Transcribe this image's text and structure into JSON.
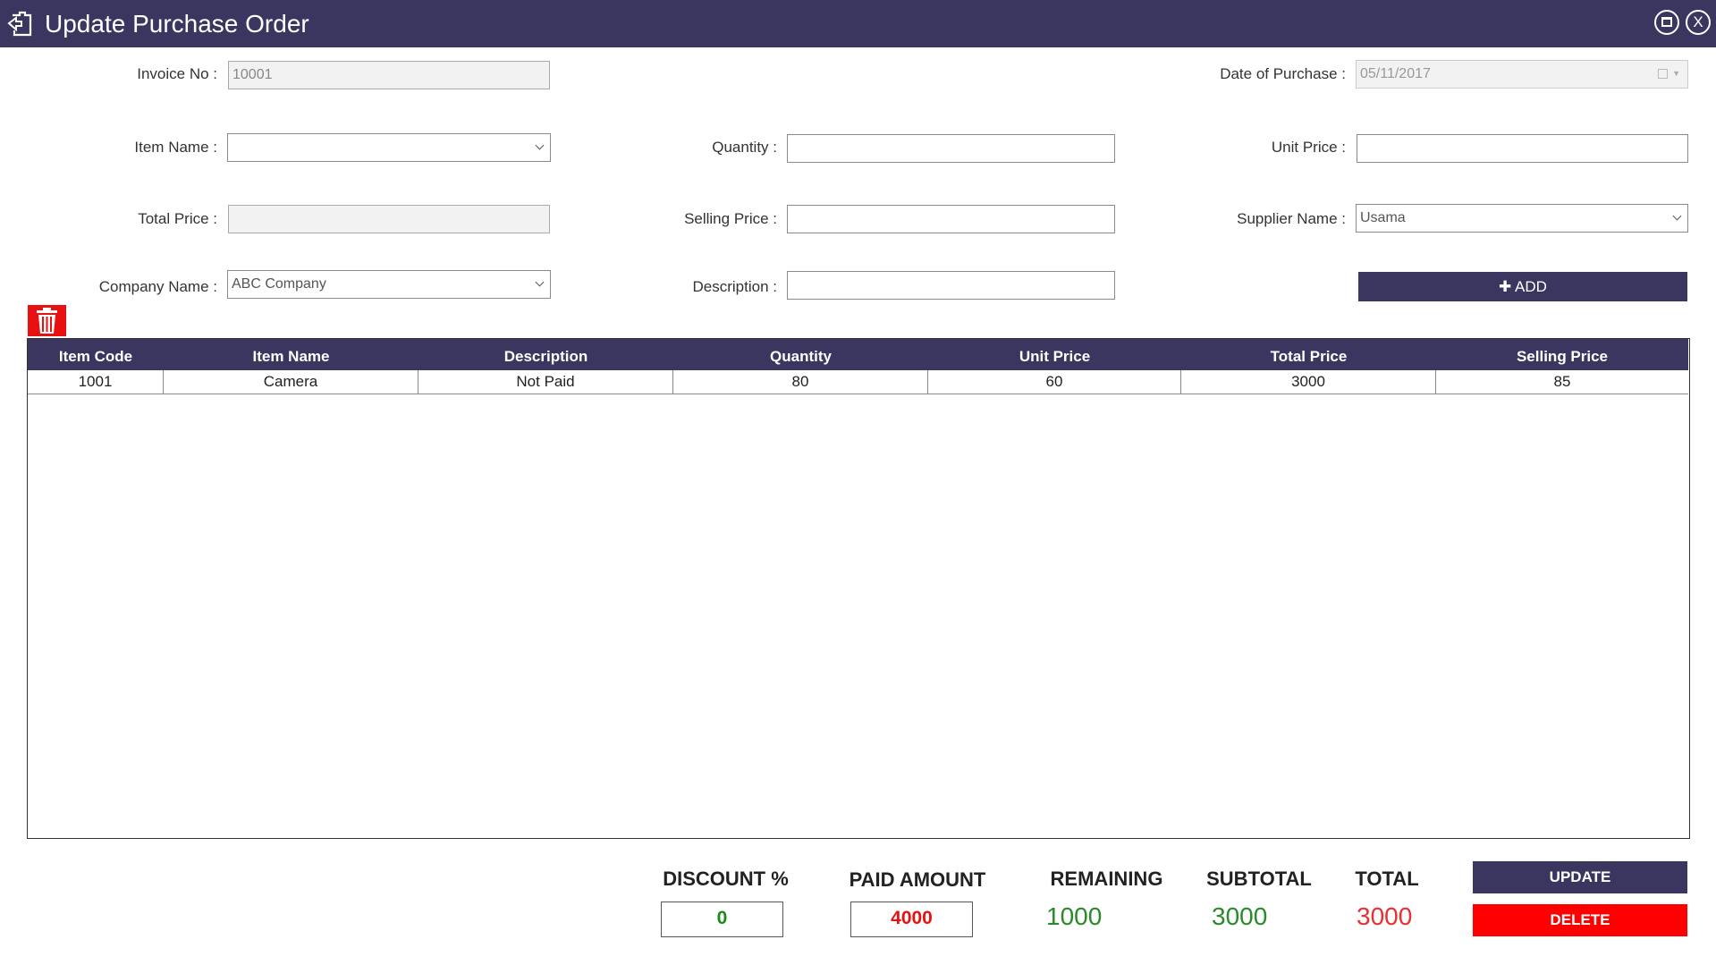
{
  "window": {
    "title": "Update Purchase Order",
    "close_label": "X",
    "accent": "#3a3660"
  },
  "form": {
    "invoice_no": {
      "label": "Invoice No :",
      "value": "10001"
    },
    "date_of_purchase": {
      "label": "Date of Purchase :",
      "value": "05/11/2017"
    },
    "item_name": {
      "label": "Item Name :",
      "value": ""
    },
    "quantity": {
      "label": "Quantity :",
      "value": ""
    },
    "unit_price": {
      "label": "Unit Price :",
      "value": ""
    },
    "total_price": {
      "label": "Total Price :",
      "value": ""
    },
    "selling_price": {
      "label": "Selling Price :",
      "value": ""
    },
    "supplier_name": {
      "label": "Supplier Name :",
      "value": "Usama"
    },
    "company_name": {
      "label": "Company Name :",
      "value": "ABC Company"
    },
    "description": {
      "label": "Description :",
      "value": ""
    },
    "add_label": "✚ ADD"
  },
  "grid": {
    "columns": [
      "Item Code",
      "Item Name",
      "Description",
      "Quantity",
      "Unit Price",
      "Total Price",
      "Selling Price"
    ],
    "rows": [
      [
        "1001",
        "Camera",
        "Not Paid",
        "80",
        "60",
        "3000",
        "85"
      ]
    ]
  },
  "summary": {
    "discount": {
      "label": "DISCOUNT %",
      "value": "0",
      "color": "#1a8a1a"
    },
    "paid_amount": {
      "label": "PAID AMOUNT",
      "value": "4000",
      "color": "#e81010"
    },
    "remaining": {
      "label": "REMAINING",
      "value": "1000",
      "color": "#2a8a2a"
    },
    "subtotal": {
      "label": "SUBTOTAL",
      "value": "3000",
      "color": "#2a8a2a"
    },
    "total": {
      "label": "TOTAL",
      "value": "3000",
      "color": "#e83030"
    },
    "update_label": "UPDATE",
    "delete_label": "DELETE"
  }
}
